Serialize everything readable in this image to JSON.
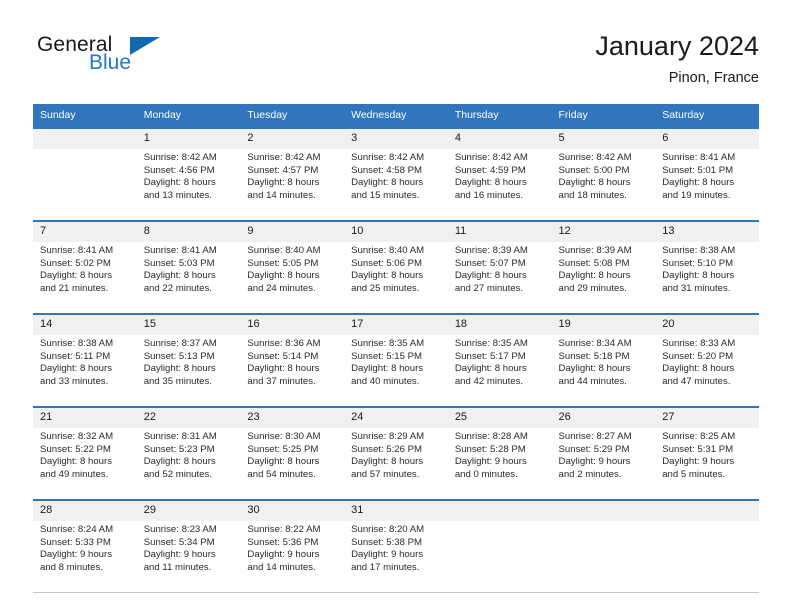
{
  "brand": {
    "word_one": "General",
    "word_two": "Blue",
    "triangle_icon": "triangle-icon",
    "accent_color": "#1269b0",
    "blue_text_color": "#2176c7"
  },
  "header": {
    "title": "January 2024",
    "location": "Pinon, France"
  },
  "calendar": {
    "header_bg": "#3176bc",
    "daynum_bg": "#f0f0f0",
    "weekdays": [
      "Sunday",
      "Monday",
      "Tuesday",
      "Wednesday",
      "Thursday",
      "Friday",
      "Saturday"
    ],
    "weeks": [
      [
        {
          "day": "",
          "sunrise": "",
          "sunset": "",
          "daylight1": "",
          "daylight2": ""
        },
        {
          "day": "1",
          "sunrise": "Sunrise: 8:42 AM",
          "sunset": "Sunset: 4:56 PM",
          "daylight1": "Daylight: 8 hours",
          "daylight2": "and 13 minutes."
        },
        {
          "day": "2",
          "sunrise": "Sunrise: 8:42 AM",
          "sunset": "Sunset: 4:57 PM",
          "daylight1": "Daylight: 8 hours",
          "daylight2": "and 14 minutes."
        },
        {
          "day": "3",
          "sunrise": "Sunrise: 8:42 AM",
          "sunset": "Sunset: 4:58 PM",
          "daylight1": "Daylight: 8 hours",
          "daylight2": "and 15 minutes."
        },
        {
          "day": "4",
          "sunrise": "Sunrise: 8:42 AM",
          "sunset": "Sunset: 4:59 PM",
          "daylight1": "Daylight: 8 hours",
          "daylight2": "and 16 minutes."
        },
        {
          "day": "5",
          "sunrise": "Sunrise: 8:42 AM",
          "sunset": "Sunset: 5:00 PM",
          "daylight1": "Daylight: 8 hours",
          "daylight2": "and 18 minutes."
        },
        {
          "day": "6",
          "sunrise": "Sunrise: 8:41 AM",
          "sunset": "Sunset: 5:01 PM",
          "daylight1": "Daylight: 8 hours",
          "daylight2": "and 19 minutes."
        }
      ],
      [
        {
          "day": "7",
          "sunrise": "Sunrise: 8:41 AM",
          "sunset": "Sunset: 5:02 PM",
          "daylight1": "Daylight: 8 hours",
          "daylight2": "and 21 minutes."
        },
        {
          "day": "8",
          "sunrise": "Sunrise: 8:41 AM",
          "sunset": "Sunset: 5:03 PM",
          "daylight1": "Daylight: 8 hours",
          "daylight2": "and 22 minutes."
        },
        {
          "day": "9",
          "sunrise": "Sunrise: 8:40 AM",
          "sunset": "Sunset: 5:05 PM",
          "daylight1": "Daylight: 8 hours",
          "daylight2": "and 24 minutes."
        },
        {
          "day": "10",
          "sunrise": "Sunrise: 8:40 AM",
          "sunset": "Sunset: 5:06 PM",
          "daylight1": "Daylight: 8 hours",
          "daylight2": "and 25 minutes."
        },
        {
          "day": "11",
          "sunrise": "Sunrise: 8:39 AM",
          "sunset": "Sunset: 5:07 PM",
          "daylight1": "Daylight: 8 hours",
          "daylight2": "and 27 minutes."
        },
        {
          "day": "12",
          "sunrise": "Sunrise: 8:39 AM",
          "sunset": "Sunset: 5:08 PM",
          "daylight1": "Daylight: 8 hours",
          "daylight2": "and 29 minutes."
        },
        {
          "day": "13",
          "sunrise": "Sunrise: 8:38 AM",
          "sunset": "Sunset: 5:10 PM",
          "daylight1": "Daylight: 8 hours",
          "daylight2": "and 31 minutes."
        }
      ],
      [
        {
          "day": "14",
          "sunrise": "Sunrise: 8:38 AM",
          "sunset": "Sunset: 5:11 PM",
          "daylight1": "Daylight: 8 hours",
          "daylight2": "and 33 minutes."
        },
        {
          "day": "15",
          "sunrise": "Sunrise: 8:37 AM",
          "sunset": "Sunset: 5:13 PM",
          "daylight1": "Daylight: 8 hours",
          "daylight2": "and 35 minutes."
        },
        {
          "day": "16",
          "sunrise": "Sunrise: 8:36 AM",
          "sunset": "Sunset: 5:14 PM",
          "daylight1": "Daylight: 8 hours",
          "daylight2": "and 37 minutes."
        },
        {
          "day": "17",
          "sunrise": "Sunrise: 8:35 AM",
          "sunset": "Sunset: 5:15 PM",
          "daylight1": "Daylight: 8 hours",
          "daylight2": "and 40 minutes."
        },
        {
          "day": "18",
          "sunrise": "Sunrise: 8:35 AM",
          "sunset": "Sunset: 5:17 PM",
          "daylight1": "Daylight: 8 hours",
          "daylight2": "and 42 minutes."
        },
        {
          "day": "19",
          "sunrise": "Sunrise: 8:34 AM",
          "sunset": "Sunset: 5:18 PM",
          "daylight1": "Daylight: 8 hours",
          "daylight2": "and 44 minutes."
        },
        {
          "day": "20",
          "sunrise": "Sunrise: 8:33 AM",
          "sunset": "Sunset: 5:20 PM",
          "daylight1": "Daylight: 8 hours",
          "daylight2": "and 47 minutes."
        }
      ],
      [
        {
          "day": "21",
          "sunrise": "Sunrise: 8:32 AM",
          "sunset": "Sunset: 5:22 PM",
          "daylight1": "Daylight: 8 hours",
          "daylight2": "and 49 minutes."
        },
        {
          "day": "22",
          "sunrise": "Sunrise: 8:31 AM",
          "sunset": "Sunset: 5:23 PM",
          "daylight1": "Daylight: 8 hours",
          "daylight2": "and 52 minutes."
        },
        {
          "day": "23",
          "sunrise": "Sunrise: 8:30 AM",
          "sunset": "Sunset: 5:25 PM",
          "daylight1": "Daylight: 8 hours",
          "daylight2": "and 54 minutes."
        },
        {
          "day": "24",
          "sunrise": "Sunrise: 8:29 AM",
          "sunset": "Sunset: 5:26 PM",
          "daylight1": "Daylight: 8 hours",
          "daylight2": "and 57 minutes."
        },
        {
          "day": "25",
          "sunrise": "Sunrise: 8:28 AM",
          "sunset": "Sunset: 5:28 PM",
          "daylight1": "Daylight: 9 hours",
          "daylight2": "and 0 minutes."
        },
        {
          "day": "26",
          "sunrise": "Sunrise: 8:27 AM",
          "sunset": "Sunset: 5:29 PM",
          "daylight1": "Daylight: 9 hours",
          "daylight2": "and 2 minutes."
        },
        {
          "day": "27",
          "sunrise": "Sunrise: 8:25 AM",
          "sunset": "Sunset: 5:31 PM",
          "daylight1": "Daylight: 9 hours",
          "daylight2": "and 5 minutes."
        }
      ],
      [
        {
          "day": "28",
          "sunrise": "Sunrise: 8:24 AM",
          "sunset": "Sunset: 5:33 PM",
          "daylight1": "Daylight: 9 hours",
          "daylight2": "and 8 minutes."
        },
        {
          "day": "29",
          "sunrise": "Sunrise: 8:23 AM",
          "sunset": "Sunset: 5:34 PM",
          "daylight1": "Daylight: 9 hours",
          "daylight2": "and 11 minutes."
        },
        {
          "day": "30",
          "sunrise": "Sunrise: 8:22 AM",
          "sunset": "Sunset: 5:36 PM",
          "daylight1": "Daylight: 9 hours",
          "daylight2": "and 14 minutes."
        },
        {
          "day": "31",
          "sunrise": "Sunrise: 8:20 AM",
          "sunset": "Sunset: 5:38 PM",
          "daylight1": "Daylight: 9 hours",
          "daylight2": "and 17 minutes."
        },
        {
          "day": "",
          "sunrise": "",
          "sunset": "",
          "daylight1": "",
          "daylight2": ""
        },
        {
          "day": "",
          "sunrise": "",
          "sunset": "",
          "daylight1": "",
          "daylight2": ""
        },
        {
          "day": "",
          "sunrise": "",
          "sunset": "",
          "daylight1": "",
          "daylight2": ""
        }
      ]
    ]
  }
}
